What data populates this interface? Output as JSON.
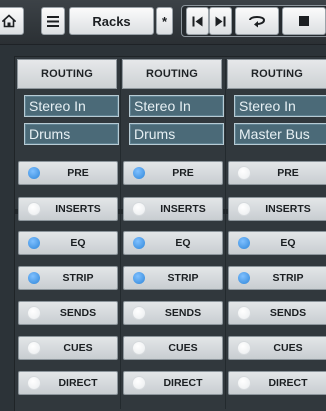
{
  "toolbar": {
    "racks_label": "Racks",
    "icons": {
      "home": "home-icon",
      "menu": "menu-icon",
      "star": "star-icon",
      "prev": "go-to-previous-marker-icon",
      "next": "go-to-next-marker-icon",
      "cycle": "cycle-icon",
      "stop": "stop-icon"
    }
  },
  "colors": {
    "background": "#2c3338",
    "led_on": "#2f86d9",
    "led_off": "#ffffff",
    "routing_field": "#4b6a78"
  },
  "channels": [
    {
      "routing_header": "ROUTING",
      "input": "Stereo In",
      "output": "Drums",
      "racks": [
        {
          "label": "PRE",
          "on": true
        },
        {
          "label": "INSERTS",
          "on": false
        },
        {
          "label": "EQ",
          "on": true
        },
        {
          "label": "STRIP",
          "on": true
        },
        {
          "label": "SENDS",
          "on": false
        },
        {
          "label": "CUES",
          "on": false
        },
        {
          "label": "DIRECT",
          "on": false
        }
      ]
    },
    {
      "routing_header": "ROUTING",
      "input": "Stereo In",
      "output": "Drums",
      "racks": [
        {
          "label": "PRE",
          "on": true
        },
        {
          "label": "INSERTS",
          "on": false
        },
        {
          "label": "EQ",
          "on": true
        },
        {
          "label": "STRIP",
          "on": true
        },
        {
          "label": "SENDS",
          "on": false
        },
        {
          "label": "CUES",
          "on": false
        },
        {
          "label": "DIRECT",
          "on": false
        }
      ]
    },
    {
      "routing_header": "ROUTING",
      "input": "Stereo In",
      "output": "Master Bus",
      "racks": [
        {
          "label": "PRE",
          "on": false
        },
        {
          "label": "INSERTS",
          "on": false
        },
        {
          "label": "EQ",
          "on": true
        },
        {
          "label": "STRIP",
          "on": true
        },
        {
          "label": "SENDS",
          "on": false
        },
        {
          "label": "CUES",
          "on": false
        },
        {
          "label": "DIRECT",
          "on": false
        }
      ]
    }
  ]
}
